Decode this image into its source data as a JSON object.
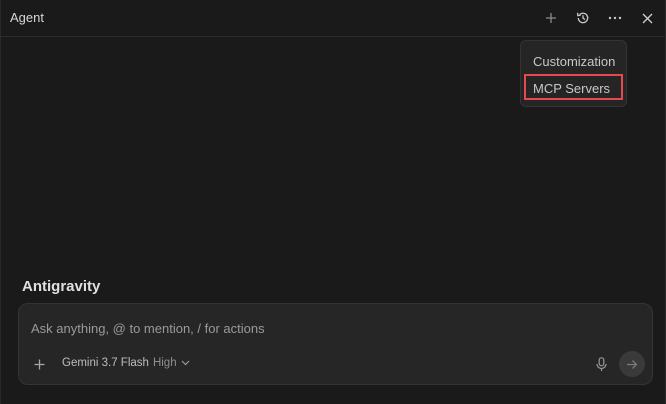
{
  "window": {
    "title": "Agent"
  },
  "header_icons": {
    "new": "plus-icon",
    "history": "history-icon",
    "more": "ellipsis-icon",
    "close": "close-icon"
  },
  "menu": {
    "items": [
      {
        "label": "Customization"
      },
      {
        "label": "MCP Servers",
        "highlighted": true
      }
    ],
    "highlight_color": "#e5484d"
  },
  "main": {
    "section_title": "Antigravity"
  },
  "composer": {
    "placeholder": "Ask anything, @ to mention, / for actions",
    "model": {
      "name": "Gemini 3.7 Flash",
      "level": "High"
    }
  }
}
